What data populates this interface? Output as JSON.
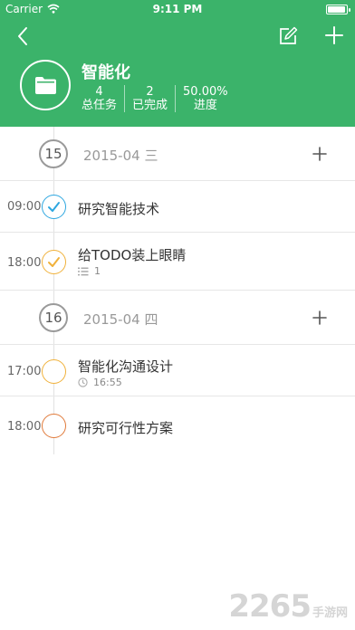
{
  "status_bar": {
    "carrier": "Carrier",
    "time": "9:11 PM"
  },
  "header": {
    "project_name": "智能化",
    "stats": [
      {
        "value": "4",
        "label": "总任务"
      },
      {
        "value": "2",
        "label": "已完成"
      },
      {
        "value": "50.00%",
        "label": "进度"
      }
    ]
  },
  "days": [
    {
      "day": "15",
      "date": "2015-04 三"
    },
    {
      "day": "16",
      "date": "2015-04 四"
    }
  ],
  "tasks": [
    {
      "time": "09:00",
      "title": "研究智能技术",
      "state": "done",
      "color": "#2ea7e0"
    },
    {
      "time": "18:00",
      "title": "给TODO装上眼睛",
      "state": "done",
      "color": "#f0b13a",
      "subtask_count": "1"
    },
    {
      "time": "17:00",
      "title": "智能化沟通设计",
      "state": "open",
      "color": "#f0b13a",
      "reminder": "16:55"
    },
    {
      "time": "18:00",
      "title": "研究可行性方案",
      "state": "open",
      "color": "#e07a3a"
    }
  ],
  "colors": {
    "header_green": "#3bb36a",
    "done_blue": "#2ea7e0",
    "orange": "#f0b13a",
    "red_orange": "#e07a3a"
  },
  "watermark": {
    "number": "2265",
    "text": "手游网"
  }
}
